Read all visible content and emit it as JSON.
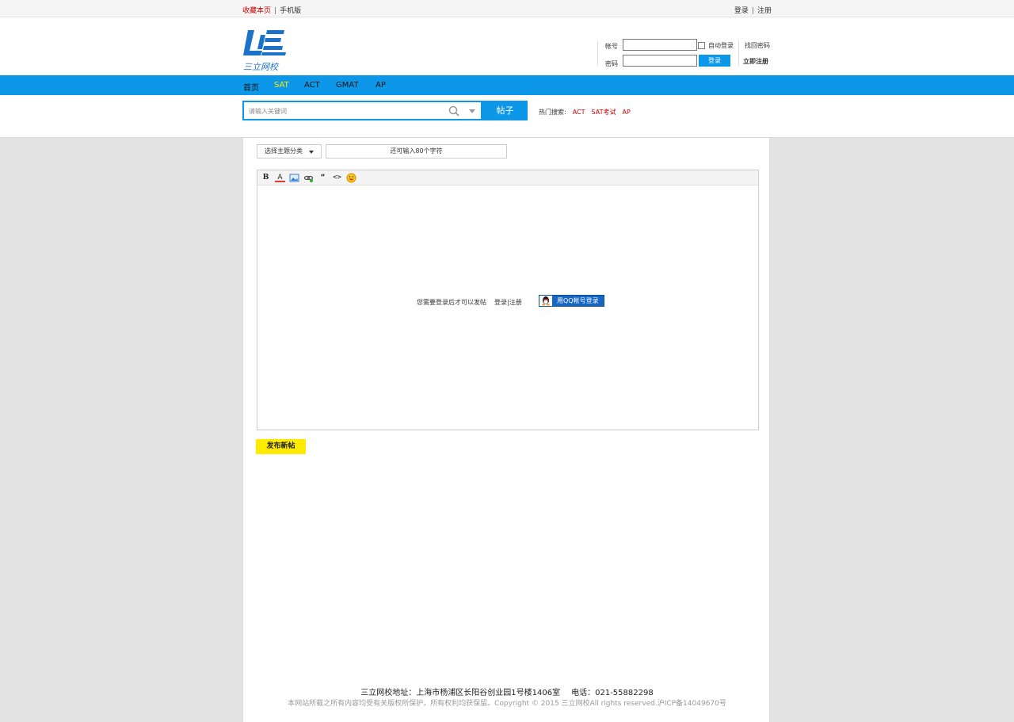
{
  "topbar": {
    "bookmark": "收藏本页",
    "mobile": "手机版",
    "login": "登录",
    "register": "注册"
  },
  "logo": {
    "text": "三立网校"
  },
  "login_box": {
    "account_label": "帐号",
    "password_label": "密码",
    "auto_login": "自动登录",
    "login_button": "登录",
    "forgot_password": "找回密码",
    "register_now": "立即注册"
  },
  "nav": {
    "items": [
      {
        "label": "首页"
      },
      {
        "label": "SAT"
      },
      {
        "label": "ACT"
      },
      {
        "label": "GMAT"
      },
      {
        "label": "AP"
      }
    ],
    "active_index": 1
  },
  "search": {
    "placeholder": "请输入关键词",
    "button": "帖子",
    "hot_label": "热门搜索:",
    "hot_keywords": [
      "ACT",
      "SAT考试",
      "AP"
    ]
  },
  "post_form": {
    "category_select": "选择主题分类",
    "title_hint": "还可输入80个字符",
    "toolbar": [
      "B",
      "A",
      "image",
      "link",
      "quote",
      "code",
      "smiley"
    ],
    "login_required": "您需要登录后才可以发帖",
    "login_link": "登录",
    "register_link": "注册",
    "qq_login": "用QQ帐号登录",
    "publish_button": "发布新帖"
  },
  "footer": {
    "address": "三立网校地址：上海市杨浦区长阳谷创业园1号楼1406室",
    "phone": "电话：021-55882298",
    "copyright": "本网站所载之所有内容均受有关版权所保护，所有权利均获保留。Copyright © 2015 三立网校All rights reserved.沪ICP备14049670号"
  },
  "colors": {
    "brand_blue": "#0c97e8",
    "active_nav": "#ffea00",
    "hot_red": "#cc0000",
    "publish_yellow": "#ffea00"
  }
}
